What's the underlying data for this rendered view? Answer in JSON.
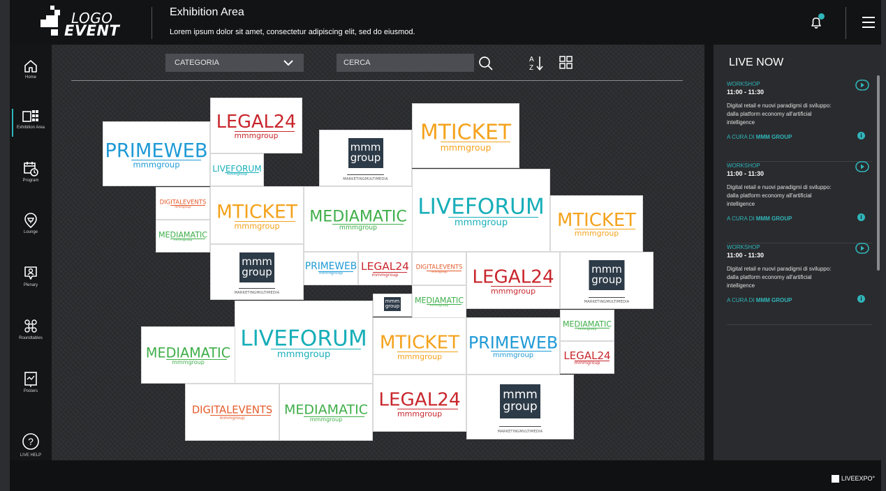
{
  "header": {
    "logo_line1": "LOGO",
    "logo_line2": "EVENT",
    "title": "Exhibition Area",
    "subtitle": "Lorem ipsum dolor sit amet, consectetur adipiscing elit, sed do eiusmod."
  },
  "sidebar": {
    "items": [
      {
        "label": "Home",
        "icon": "home-icon"
      },
      {
        "label": "Exhibition Area",
        "icon": "exhibition-icon",
        "active": true
      },
      {
        "label": "Program",
        "icon": "calendar-clock-icon"
      },
      {
        "label": "Lounge",
        "icon": "lounge-icon"
      },
      {
        "label": "Plenary",
        "icon": "plenary-icon"
      },
      {
        "label": "Roundtables",
        "icon": "roundtables-icon"
      },
      {
        "label": "Posters",
        "icon": "posters-icon"
      }
    ],
    "help_label": "LIVE HELP"
  },
  "toolbar": {
    "category_label": "CATEGORIA",
    "search_placeholder": "CERCA"
  },
  "brands": {
    "primeweb": "PRIMEWEB",
    "legal24": "LEGAL24",
    "liveforum": "LIVEFORUM",
    "mticket": "MTICKET",
    "mediamatic": "MEDIAMATIC",
    "digitalevents": "DIGITALEVENTS",
    "sub": "mmmgroup",
    "mmm_line1": "mmm",
    "mmm_line2": "group",
    "mmm_caption": "MARKETINGMULTIMEDIA"
  },
  "brand_colors": {
    "primeweb": "#1f9ad6",
    "legal24": "#c8262c",
    "liveforum": "#17aeb8",
    "mticket": "#f4a21c",
    "mediamatic": "#3fae49",
    "digitalevents": "#e45a2a"
  },
  "live": {
    "title": "LIVE NOW",
    "items": [
      {
        "category": "WORKSHOP",
        "time": "11:00 - 11:30",
        "description": "Digital retail e nuovi paradigmi di sviluppo: dalla platform economy all'artificial intelligence",
        "by_prefix": "A CURA DI ",
        "by_name": "MMM GROUP"
      },
      {
        "category": "WORKSHOP",
        "time": "11:00 - 11:30",
        "description": "Digital retail e nuovi paradigmi di sviluppo: dalla platform economy all'artificial intelligence",
        "by_prefix": "A CURA DI ",
        "by_name": "MMM GROUP"
      },
      {
        "category": "WORKSHOP",
        "time": "11:00 - 11:30",
        "description": "Digital retail e nuovi paradigmi di sviluppo: dalla platform economy all'artificial intelligence",
        "by_prefix": "A CURA DI ",
        "by_name": "MMM GROUP"
      }
    ]
  },
  "footer": {
    "brand": "LIVEEXPO°"
  },
  "colors": {
    "accent": "#2fb5ba",
    "background": "#131416",
    "panel": "#2a2b2e"
  }
}
